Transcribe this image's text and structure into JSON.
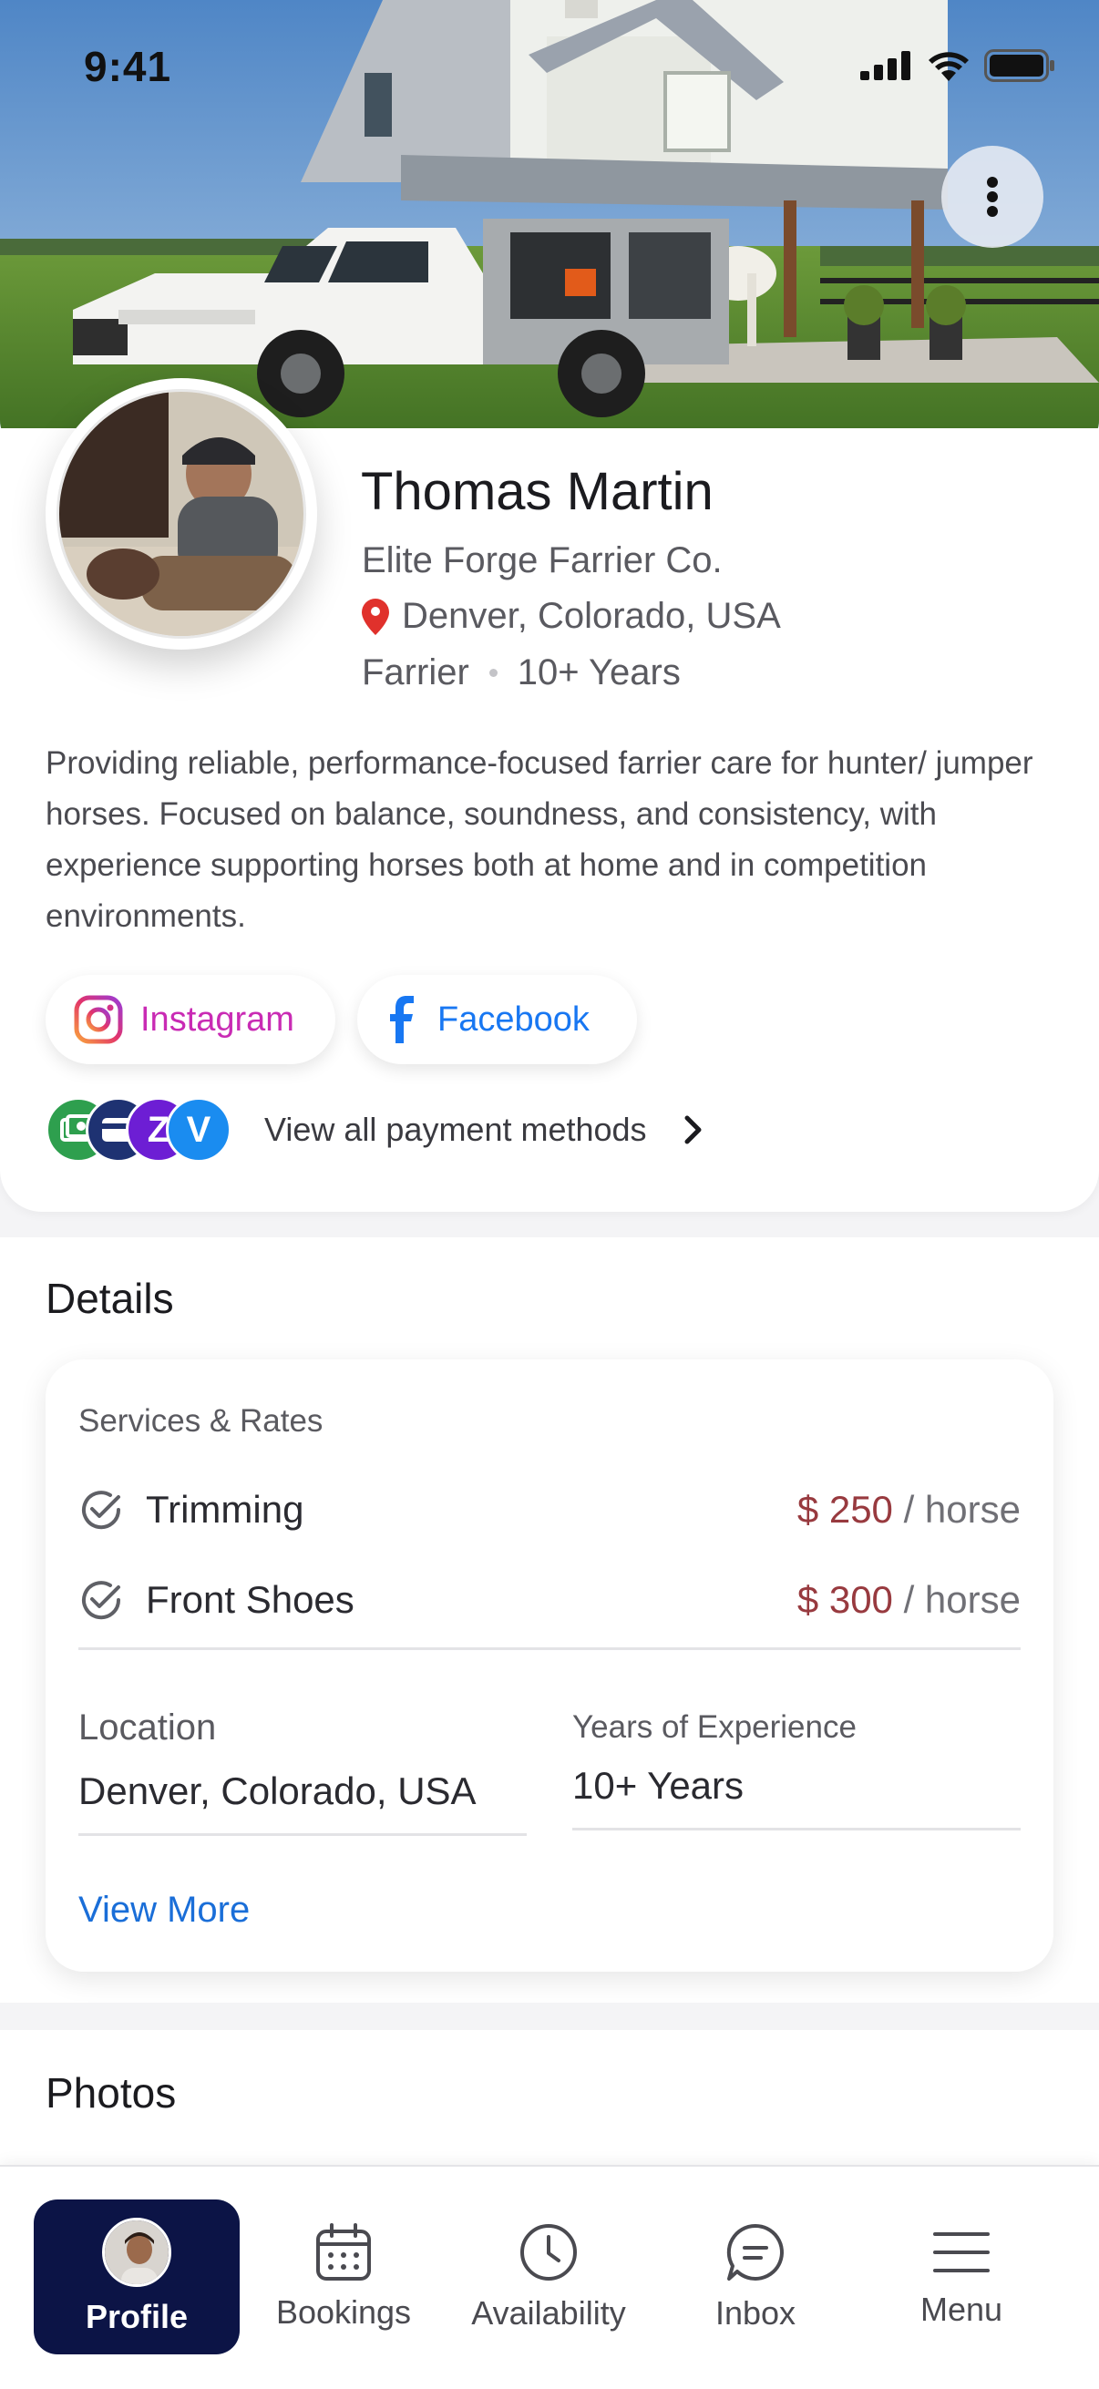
{
  "status_bar": {
    "time": "9:41"
  },
  "profile": {
    "name": "Thomas Martin",
    "company": "Elite Forge Farrier Co.",
    "location": "Denver, Colorado, USA",
    "role": "Farrier",
    "experience": "10+ Years",
    "bio": "Providing reliable, performance-focused farrier care for hunter/ jumper horses. Focused on balance, soundness, and consistency, with experience supporting horses both at home and in competition environments."
  },
  "social": {
    "instagram_label": "Instagram",
    "facebook_label": "Facebook"
  },
  "payments": {
    "label": "View all payment methods",
    "icons": [
      "cash-icon",
      "card-icon",
      "zelle-icon",
      "venmo-icon"
    ]
  },
  "details": {
    "title": "Details",
    "services_heading": "Services & Rates",
    "services": [
      {
        "name": "Trimming",
        "price": "$ 250",
        "unit": "/ horse"
      },
      {
        "name": "Front Shoes",
        "price": "$ 300",
        "unit": "/ horse"
      }
    ],
    "location_label": "Location",
    "location_value": "Denver, Colorado, USA",
    "experience_label": "Years of Experience",
    "experience_value": "10+ Years",
    "view_more": "View More"
  },
  "photos": {
    "title": "Photos"
  },
  "bottom_nav": {
    "items": [
      {
        "label": "Profile",
        "icon": "avatar",
        "active": true
      },
      {
        "label": "Bookings",
        "icon": "calendar-icon"
      },
      {
        "label": "Availability",
        "icon": "clock-icon"
      },
      {
        "label": "Inbox",
        "icon": "chat-icon"
      },
      {
        "label": "Menu",
        "icon": "hamburger-icon"
      }
    ]
  },
  "colors": {
    "price": "#983a3f",
    "link": "#1a6ed8",
    "nav_active": "#0c1446",
    "instagram": "#c92bb4",
    "facebook": "#1877f2"
  }
}
